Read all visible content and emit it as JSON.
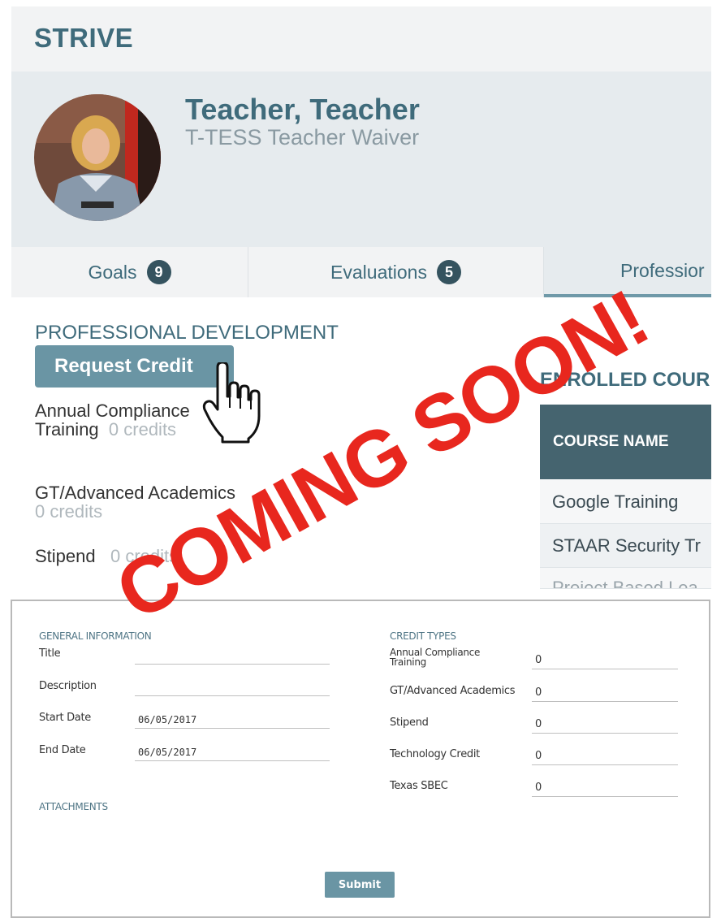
{
  "header": {
    "brand": "STRIVE"
  },
  "profile": {
    "name": "Teacher, Teacher",
    "role": "T-TESS Teacher Waiver"
  },
  "tabs": [
    {
      "label": "Goals",
      "badge": "9"
    },
    {
      "label": "Evaluations",
      "badge": "5"
    },
    {
      "label": "Professior"
    }
  ],
  "pd": {
    "title": "PROFESSIONAL DEVELOPMENT",
    "request_button": "Request Credit",
    "credits": [
      {
        "label": "Annual Compliance Training",
        "value": "0 credits"
      },
      {
        "label": "GT/Advanced Academics",
        "value": "0 credits"
      },
      {
        "label": "Stipend",
        "value": "0 credits"
      }
    ]
  },
  "enrolled": {
    "title": "ENROLLED COUR",
    "column_header": "COURSE NAME",
    "rows": [
      "Google Training",
      "STAAR Security Tr",
      "Project Based Lea"
    ]
  },
  "form": {
    "general_heading": "GENERAL INFORMATION",
    "fields": {
      "title_label": "Title",
      "title_value": "",
      "description_label": "Description",
      "description_value": "",
      "start_label": "Start Date",
      "start_value": "06/05/2017",
      "end_label": "End Date",
      "end_value": "06/05/2017"
    },
    "attachments_heading": "ATTACHMENTS",
    "credit_types_heading": "CREDIT TYPES",
    "credit_types": [
      {
        "label": "Annual Compliance Training",
        "value": "0"
      },
      {
        "label": "GT/Advanced Academics",
        "value": "0"
      },
      {
        "label": "Stipend",
        "value": "0"
      },
      {
        "label": "Technology Credit",
        "value": "0"
      },
      {
        "label": "Texas SBEC",
        "value": "0"
      }
    ],
    "submit_label": "Submit"
  },
  "overlay": {
    "text": "COMING SOON!"
  },
  "colors": {
    "brand": "#3f6b7b",
    "button": "#6a95a4",
    "table_header": "#45646f",
    "badge": "#35535f",
    "overlay_red": "#e8271e"
  },
  "icons": {
    "cursor": "pointing-hand-cursor-icon"
  }
}
